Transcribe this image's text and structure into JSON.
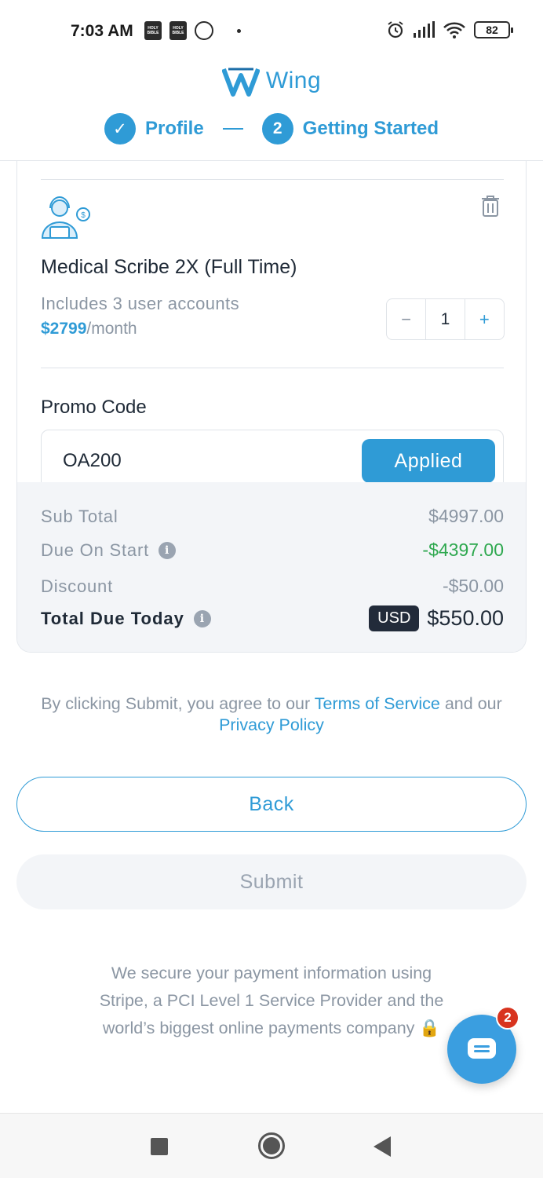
{
  "status_bar": {
    "time": "7:03 AM",
    "battery": "82",
    "bible_icon_text": "HOLY BIBLE"
  },
  "header": {
    "brand_name": "Wing",
    "steps": [
      {
        "number": "✓",
        "label": "Profile",
        "state": "completed"
      },
      {
        "number": "2",
        "label": "Getting Started",
        "state": "active"
      }
    ]
  },
  "cart_item": {
    "icon": "support-agent-icon",
    "name": "Medical Scribe 2X (Full Time)",
    "description": "Includes 3 user accounts",
    "price": "$2799",
    "price_suffix": "/month",
    "quantity": "1",
    "minus": "−",
    "plus": "+"
  },
  "promo": {
    "label": "Promo Code",
    "value": "OA200",
    "button_label": "Applied"
  },
  "summary": {
    "rows": [
      {
        "label": "Sub Total",
        "value": "$4997.00"
      },
      {
        "label": "Due On Start",
        "value": "-$4397.00"
      },
      {
        "label": "Discount",
        "value": "-$50.00"
      }
    ],
    "total_label": "Total Due Today",
    "currency": "USD",
    "total_value": "$550.00",
    "info_glyph": "i"
  },
  "terms": {
    "prefix": "By clicking Submit, you agree to our ",
    "tos_link": "Terms of Service",
    "middle": " and our",
    "privacy_link": "Privacy Policy"
  },
  "actions": {
    "back_label": "Back",
    "submit_label": "Submit"
  },
  "secure_note": {
    "line1": "We secure your payment information using",
    "line2": "Stripe, a PCI Level 1 Service Provider and the",
    "line3": "world’s biggest online payments company 🔒"
  },
  "chat": {
    "badge_count": "2"
  },
  "colors": {
    "accent": "#2f9bd6",
    "green": "#2ea84f",
    "badge_red": "#d8341f"
  }
}
